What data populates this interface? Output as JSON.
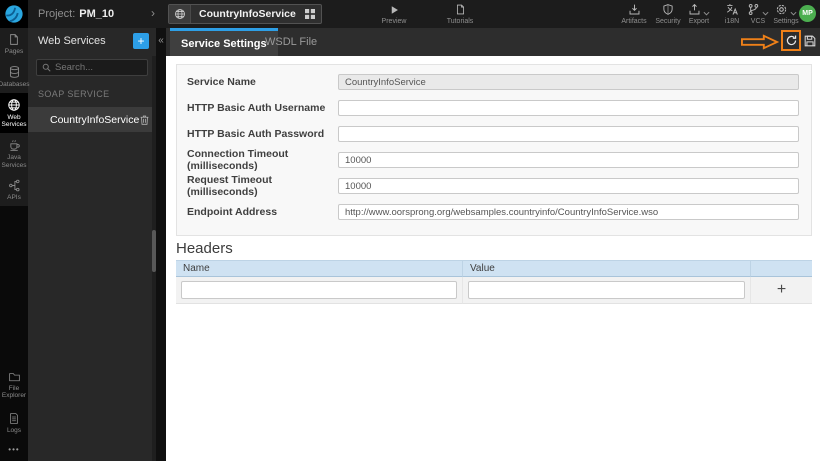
{
  "colors": {
    "accent_blue": "#2d9fe8",
    "annotation_orange": "#ef8018",
    "avatar_green": "#4caf50",
    "table_header_blue": "#cfe2f2"
  },
  "topbar": {
    "project_label": "Project:",
    "project_name": "PM_10",
    "breadcrumb_chevron": "›",
    "service_tab_label": "CountryInfoService",
    "preview_label": "Preview",
    "tutorials_label": "Tutorials",
    "artifacts_label": "Artifacts",
    "security_label": "Security",
    "export_label": "Export",
    "i18n_label": "i18N",
    "vcs_label": "VCS",
    "settings_label": "Settings",
    "avatar_initials": "MP"
  },
  "sidebar": {
    "items": [
      {
        "label": "Pages"
      },
      {
        "label": "Databases"
      },
      {
        "label": "Web Services",
        "active": true
      },
      {
        "label": "Java Services"
      },
      {
        "label": "APIs"
      }
    ],
    "bottom_items": [
      {
        "label": "File Explorer"
      },
      {
        "label": "Logs"
      }
    ],
    "more_label": "•••"
  },
  "panel": {
    "title": "Web Services",
    "add_button": "+",
    "collapse_icon": "«",
    "search_placeholder": "Search...",
    "section_title": "SOAP SERVICE",
    "items": [
      {
        "label": "CountryInfoService",
        "selected": true
      }
    ]
  },
  "main": {
    "tabs": [
      {
        "label": "Service Settings",
        "active": true
      },
      {
        "label": "WSDL File",
        "active": false
      }
    ],
    "form": {
      "fields": [
        {
          "label": "Service Name",
          "value": "CountryInfoService",
          "disabled": true
        },
        {
          "label": "HTTP Basic Auth Username",
          "value": ""
        },
        {
          "label": "HTTP Basic Auth Password",
          "value": ""
        },
        {
          "label": "Connection Timeout (milliseconds)",
          "value": "10000"
        },
        {
          "label": "Request Timeout (milliseconds)",
          "value": "10000"
        },
        {
          "label": "Endpoint Address",
          "value": "http://www.oorsprong.org/websamples.countryinfo/CountryInfoService.wso"
        }
      ]
    },
    "headers_section": {
      "title": "Headers",
      "columns": [
        "Name",
        "Value"
      ],
      "add_button": "+"
    }
  }
}
